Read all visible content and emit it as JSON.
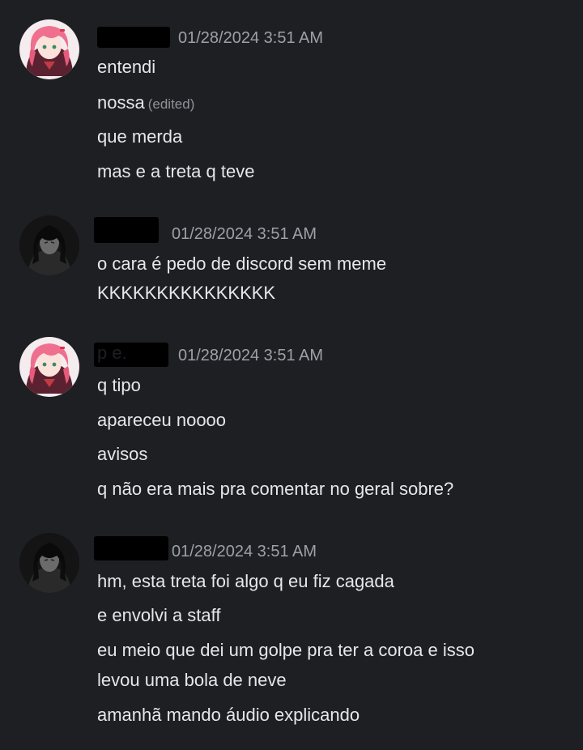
{
  "messages": [
    {
      "avatar": "pink-hair-avatar",
      "username": "",
      "timestamp": "01/28/2024 3:51 AM",
      "lines": [
        "entendi",
        "nossa",
        "que merda",
        "mas e a treta q teve"
      ],
      "edited_label": "(edited)"
    },
    {
      "avatar": "dark-hair-avatar",
      "username": "",
      "timestamp": "01/28/2024 3:51 AM",
      "lines": [
        "o cara é pedo de discord sem meme",
        "KKKKKKKKKKKKKKK"
      ]
    },
    {
      "avatar": "pink-hair-avatar",
      "username": "p   e.",
      "timestamp": "01/28/2024 3:51 AM",
      "lines": [
        "q tipo",
        "apareceu noooo",
        "avisos",
        "q não era mais pra comentar no geral sobre?"
      ]
    },
    {
      "avatar": "dark-hair-avatar",
      "username": "",
      "timestamp": "01/28/2024 3:51 AM",
      "lines": [
        "hm, esta treta foi algo q eu fiz cagada",
        "e envolvi a staff",
        "eu meio que dei um golpe pra ter a coroa e isso",
        "levou uma bola de neve",
        "amanhã mando áudio explicando"
      ]
    }
  ],
  "colors": {
    "background": "#1e1f23",
    "text": "#e6e7ea",
    "muted": "#9da0a6"
  }
}
